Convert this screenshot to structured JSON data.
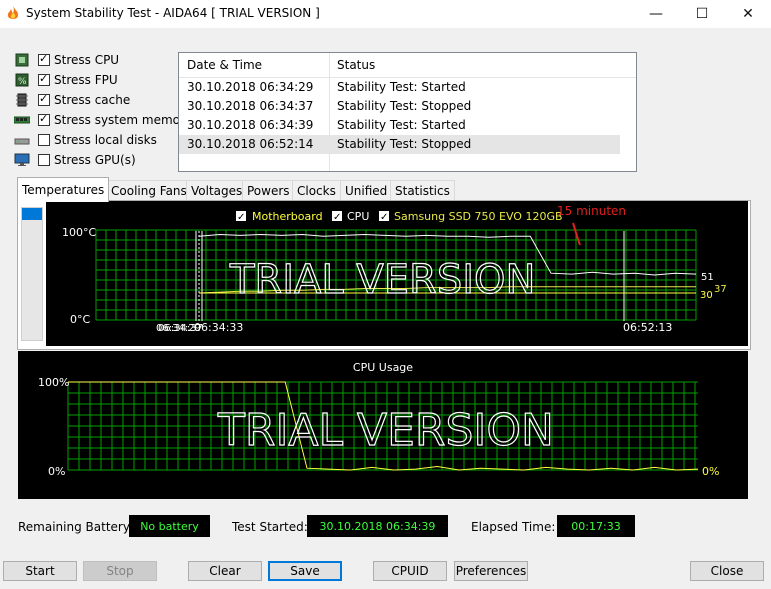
{
  "window": {
    "title": "System Stability Test - AIDA64  [ TRIAL VERSION ]",
    "minimize_glyph": "—",
    "maximize_glyph": "☐",
    "close_glyph": "✕"
  },
  "stress_options": [
    {
      "label": "Stress CPU",
      "checked": true,
      "icon": "cpu-chip-icon"
    },
    {
      "label": "Stress FPU",
      "checked": true,
      "icon": "fpu-percent-icon"
    },
    {
      "label": "Stress cache",
      "checked": true,
      "icon": "cache-chip-icon"
    },
    {
      "label": "Stress system memory",
      "checked": true,
      "icon": "memory-stick-icon"
    },
    {
      "label": "Stress local disks",
      "checked": false,
      "icon": "disk-drive-icon"
    },
    {
      "label": "Stress GPU(s)",
      "checked": false,
      "icon": "monitor-icon"
    }
  ],
  "log": {
    "columns": [
      "Date & Time",
      "Status"
    ],
    "rows": [
      {
        "time": "30.10.2018 06:34:29",
        "status": "Stability Test: Started"
      },
      {
        "time": "30.10.2018 06:34:37",
        "status": "Stability Test: Stopped"
      },
      {
        "time": "30.10.2018 06:34:39",
        "status": "Stability Test: Started"
      },
      {
        "time": "30.10.2018 06:52:14",
        "status": "Stability Test: Stopped"
      }
    ]
  },
  "tabs": [
    "Temperatures",
    "Cooling Fans",
    "Voltages",
    "Powers",
    "Clocks",
    "Unified",
    "Statistics"
  ],
  "active_tab": "Temperatures",
  "temperature_chart": {
    "legend": [
      {
        "label": "Motherboard",
        "checked": true,
        "color": "#ffff40"
      },
      {
        "label": "CPU",
        "checked": true,
        "color": "#ffffff"
      },
      {
        "label": "Samsung SSD 750 EVO 120GB",
        "checked": true,
        "color": "#ffff40"
      }
    ],
    "annotation": "15 minuten",
    "y_max_label": "100°C",
    "y_min_label": "0°C",
    "start_time_overlap": "06:34:29",
    "start_time_overlap_2": "06:34:37",
    "start_time": "06:34:33",
    "end_time": "06:52:13",
    "watermark": "TRIAL VERSION",
    "value_cpu": "51",
    "value_mb": "30",
    "value_ssd": "37",
    "colors": {
      "grid": "#00a000",
      "cpu": "#ffffff",
      "mb": "#ffff40",
      "ssd": "#e8e84a",
      "annotation": "#e02020"
    }
  },
  "chart_data": [
    {
      "type": "line",
      "title": "",
      "ylabel": "",
      "ylim": [
        0,
        100
      ],
      "series": [
        {
          "name": "CPU",
          "values": [
            93,
            95,
            94,
            95,
            94,
            95,
            93,
            94,
            95,
            94,
            93,
            94,
            93,
            93,
            92,
            93,
            93,
            52,
            51,
            53,
            51,
            52,
            50,
            52,
            51
          ]
        },
        {
          "name": "Samsung SSD 750 EVO 120GB",
          "values": [
            30,
            31,
            32,
            32,
            33,
            33,
            34,
            34,
            35,
            35,
            35,
            36,
            36,
            36,
            36,
            37,
            37,
            37,
            37,
            37,
            37,
            37,
            37,
            37,
            37
          ]
        },
        {
          "name": "Motherboard",
          "values": [
            30,
            30,
            30,
            30,
            30,
            30,
            30,
            30,
            30,
            30,
            30,
            30,
            30,
            30,
            30,
            30,
            30,
            30,
            30,
            30,
            30,
            30,
            30,
            30,
            30
          ]
        }
      ]
    },
    {
      "type": "line",
      "title": "CPU Usage",
      "ylim": [
        0,
        100
      ],
      "series": [
        {
          "name": "",
          "values": [
            100,
            100,
            100,
            100,
            100,
            100,
            100,
            100,
            100,
            100,
            100,
            2,
            1,
            0,
            3,
            0,
            1,
            4,
            0,
            2,
            1,
            0,
            3,
            1,
            0,
            2,
            0,
            3,
            0,
            1
          ]
        }
      ]
    }
  ],
  "cpu_chart": {
    "title": "CPU Usage",
    "y_max_label": "100%",
    "y_min_label": "0%",
    "current_value": "0%",
    "watermark": "TRIAL VERSION"
  },
  "footer": {
    "battery_label": "Remaining Battery:",
    "battery_value": "No battery",
    "started_label": "Test Started:",
    "started_value": "30.10.2018 06:34:39",
    "elapsed_label": "Elapsed Time:",
    "elapsed_value": "00:17:33"
  },
  "buttons": {
    "start": "Start",
    "stop": "Stop",
    "clear": "Clear",
    "save": "Save",
    "cpuid": "CPUID",
    "preferences": "Preferences",
    "close": "Close"
  }
}
